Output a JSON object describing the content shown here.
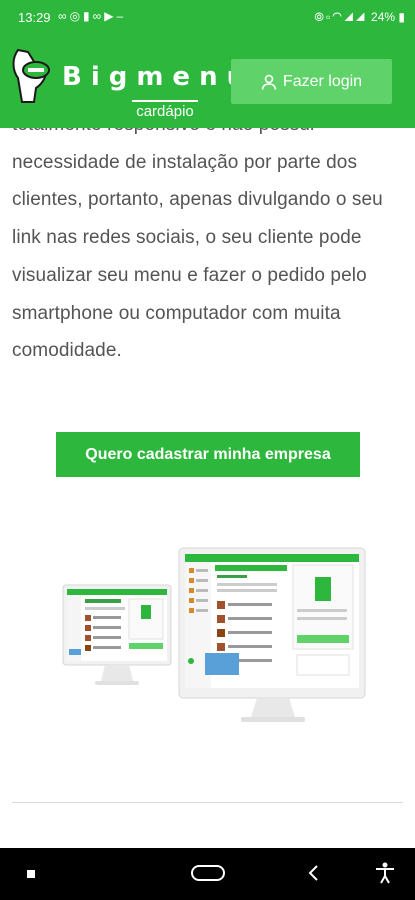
{
  "status_bar": {
    "time": "13:29",
    "notification_icons": [
      "link-icon",
      "whatsapp-icon",
      "sd-card-icon",
      "link-icon",
      "youtube-icon",
      "dash-icon"
    ],
    "system_icons": [
      "vibrate-icon",
      "volte-icon",
      "wifi-icon",
      "signal-icon",
      "signal-icon"
    ],
    "battery": "24%"
  },
  "header": {
    "brand_name": "Bigmenu",
    "brand_sub": "cardápio",
    "login_label": "Fazer login",
    "background_color": "#2db83d",
    "button_color": "#5fd36a"
  },
  "content": {
    "paragraph": "totalmente responsivo e não possui necessidade de instalação por parte dos clientes, portanto, apenas divulgando o seu link nas redes sociais, o seu cliente pode visualizar seu menu e fazer o pedido pelo smartphone ou computador com muita comodidade.",
    "cta_label": "Quero cadastrar minha empresa"
  },
  "nav_bar": {
    "buttons": [
      "recent-apps-icon",
      "home-icon",
      "back-icon",
      "accessibility-icon"
    ]
  }
}
